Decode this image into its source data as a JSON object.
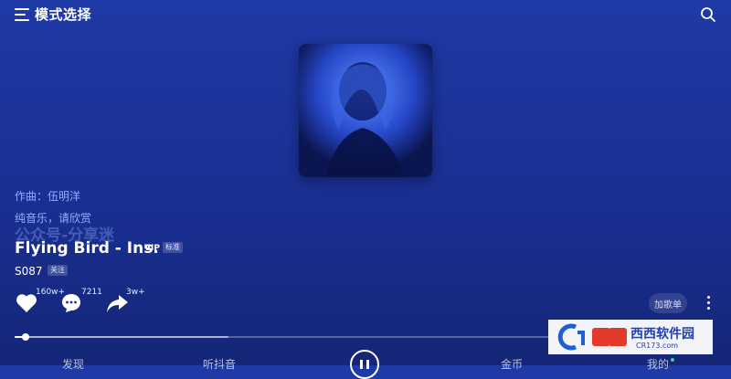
{
  "header": {
    "title": "模式选择"
  },
  "song": {
    "composer": "作曲：伍明洋",
    "note": "纯音乐，请欣赏",
    "watermark": "公众号-分享迷",
    "title": "Flying Bird - Ins.",
    "vip_badge": "VIP",
    "quality_badge": "标准",
    "artist": "S087",
    "follow_label": "关注"
  },
  "actions": {
    "like_count": "160w+",
    "comment_count": "7211",
    "share_count": "3w+",
    "add_to_playlist": "加歌单"
  },
  "progress": {
    "played_fraction": 0.02,
    "buffered_fraction": 0.4
  },
  "nav": {
    "items": [
      "发现",
      "听抖音",
      "金币",
      "我的"
    ]
  },
  "site_logo": {
    "brand": "西西软件园",
    "url_text": "CR173.com"
  },
  "colors": {
    "background_top": "#1e3aa6",
    "background_bottom": "#152677",
    "accent_text": "#8fb0ff",
    "logo_red": "#e23a2b",
    "logo_blue": "#1f5fd6"
  }
}
